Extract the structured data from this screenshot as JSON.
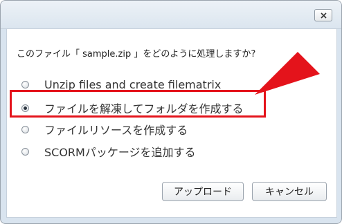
{
  "dialog": {
    "close_label": "X",
    "question": "このファイル「 sample.zip 」をどのように処理しますか?",
    "options": [
      {
        "label": "Unzip files and create filematrix",
        "checked": false
      },
      {
        "label": "ファイルを解凍してフォルダを作成する",
        "checked": true
      },
      {
        "label": "ファイルリソースを作成する",
        "checked": false
      },
      {
        "label": "SCORMパッケージを追加する",
        "checked": false
      }
    ],
    "buttons": {
      "upload": "アップロード",
      "cancel": "キャンセル"
    }
  },
  "colors": {
    "highlight": "#e4131b",
    "titlebar": "#dbe5ef"
  },
  "icons": {
    "close": "close-icon",
    "annotation_arrow": "arrow-pointer-icon"
  }
}
